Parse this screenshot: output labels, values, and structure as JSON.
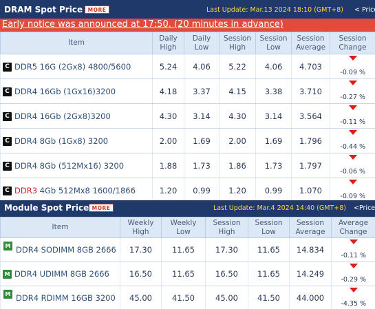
{
  "dram": {
    "title": "DRAM Spot Price",
    "more_label": "MORE",
    "update_label": "Last Update:",
    "update_value": "Mar.13 2024 18:10 (GMT+8)",
    "prev_label": "< Prices",
    "notice": "Early notice was announced at 17:50. (20 minutes in advance)",
    "columns": [
      "Item",
      "Daily High",
      "Daily Low",
      "Session High",
      "Session Low",
      "Session Average",
      "Session Change"
    ],
    "rows": [
      {
        "item_prefix": "",
        "item": "DDR5 16G (2Gx8) 4800/5600",
        "icon": "C",
        "c1": "5.24",
        "c2": "4.06",
        "c3": "5.22",
        "c4": "4.06",
        "c5": "4.703",
        "change": "-0.09 %"
      },
      {
        "item_prefix": "",
        "item": "DDR4 16Gb (1Gx16)3200",
        "icon": "C",
        "c1": "4.18",
        "c2": "3.37",
        "c3": "4.15",
        "c4": "3.38",
        "c5": "3.710",
        "change": "-0.27 %"
      },
      {
        "item_prefix": "",
        "item": "DDR4 16Gb (2Gx8)3200",
        "icon": "C",
        "c1": "4.30",
        "c2": "3.14",
        "c3": "4.30",
        "c4": "3.14",
        "c5": "3.564",
        "change": "-0.11 %"
      },
      {
        "item_prefix": "",
        "item": "DDR4 8Gb (1Gx8) 3200",
        "icon": "C",
        "c1": "2.00",
        "c2": "1.69",
        "c3": "2.00",
        "c4": "1.69",
        "c5": "1.796",
        "change": "-0.44 %"
      },
      {
        "item_prefix": "",
        "item": "DDR4 8Gb (512Mx16) 3200",
        "icon": "C",
        "c1": "1.88",
        "c2": "1.73",
        "c3": "1.86",
        "c4": "1.73",
        "c5": "1.797",
        "change": "-0.06 %"
      },
      {
        "item_prefix": "DDR3",
        "item": " 4Gb 512Mx8 1600/1866",
        "icon": "C",
        "c1": "1.20",
        "c2": "0.99",
        "c3": "1.20",
        "c4": "0.99",
        "c5": "1.070",
        "change": "-0.09 %"
      }
    ]
  },
  "module": {
    "title": "Module Spot Price",
    "more_label": "MORE",
    "update_label": "Last Update:",
    "update_value": "Mar.4 2024 14:40 (GMT+8)",
    "prev_label": "<Price",
    "columns": [
      "Item",
      "Weekly High",
      "Weekly Low",
      "Session High",
      "Session Low",
      "Session Average",
      "Average Change"
    ],
    "rows": [
      {
        "item": "DDR4 SODIMM 8GB 2666",
        "icon": "M",
        "c1": "17.30",
        "c2": "11.65",
        "c3": "17.30",
        "c4": "11.65",
        "c5": "14.834",
        "change": "-0.11 %"
      },
      {
        "item": "DDR4 UDIMM 8GB 2666",
        "icon": "M",
        "c1": "16.50",
        "c2": "11.65",
        "c3": "16.50",
        "c4": "11.65",
        "c5": "14.249",
        "change": "-0.29 %"
      },
      {
        "item": "DDR4 RDIMM 16GB 3200",
        "icon": "M",
        "c1": "45.00",
        "c2": "41.50",
        "c3": "45.00",
        "c4": "41.50",
        "c5": "44.000",
        "change": "-4.35 %"
      }
    ]
  },
  "icons": {
    "chip": "chip-icon",
    "module": "module-icon",
    "down": "down-triangle-icon"
  },
  "colors": {
    "header_bg": "#1f3a6a",
    "notice_bg": "#e24a3c",
    "update_text": "#ffd84a",
    "down": "#e01b1b",
    "ddr3": "#d62020"
  }
}
